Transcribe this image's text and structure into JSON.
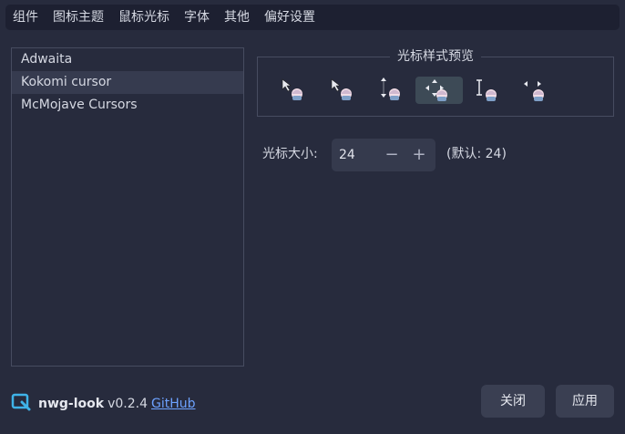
{
  "menu": {
    "items": [
      "组件",
      "图标主题",
      "鼠标光标",
      "字体",
      "其他",
      "偏好设置"
    ]
  },
  "themes": {
    "items": [
      "Adwaita",
      "Kokomi cursor",
      "McMojave Cursors"
    ],
    "selected_index": 1
  },
  "preview": {
    "title": "光标样式预览",
    "cursors": [
      "arrow-cursor-icon",
      "pointer-cursor-icon",
      "resize-vertical-cursor-icon",
      "move-cursor-icon",
      "text-cursor-icon",
      "resize-horizontal-cursor-icon"
    ],
    "active_index": 3
  },
  "size": {
    "label": "光标大小:",
    "value": "24",
    "minus": "−",
    "plus": "+",
    "default_note": "(默认: 24)"
  },
  "footer": {
    "app_name": "nwg-look",
    "version": "v0.2.4",
    "link_label": "GitHub",
    "close_label": "关闭",
    "apply_label": "应用"
  },
  "colors": {
    "background": "#272b3d",
    "menubar": "#1d2031",
    "selection": "#363b4f",
    "link": "#6da2ff",
    "button": "#3a3f52"
  }
}
